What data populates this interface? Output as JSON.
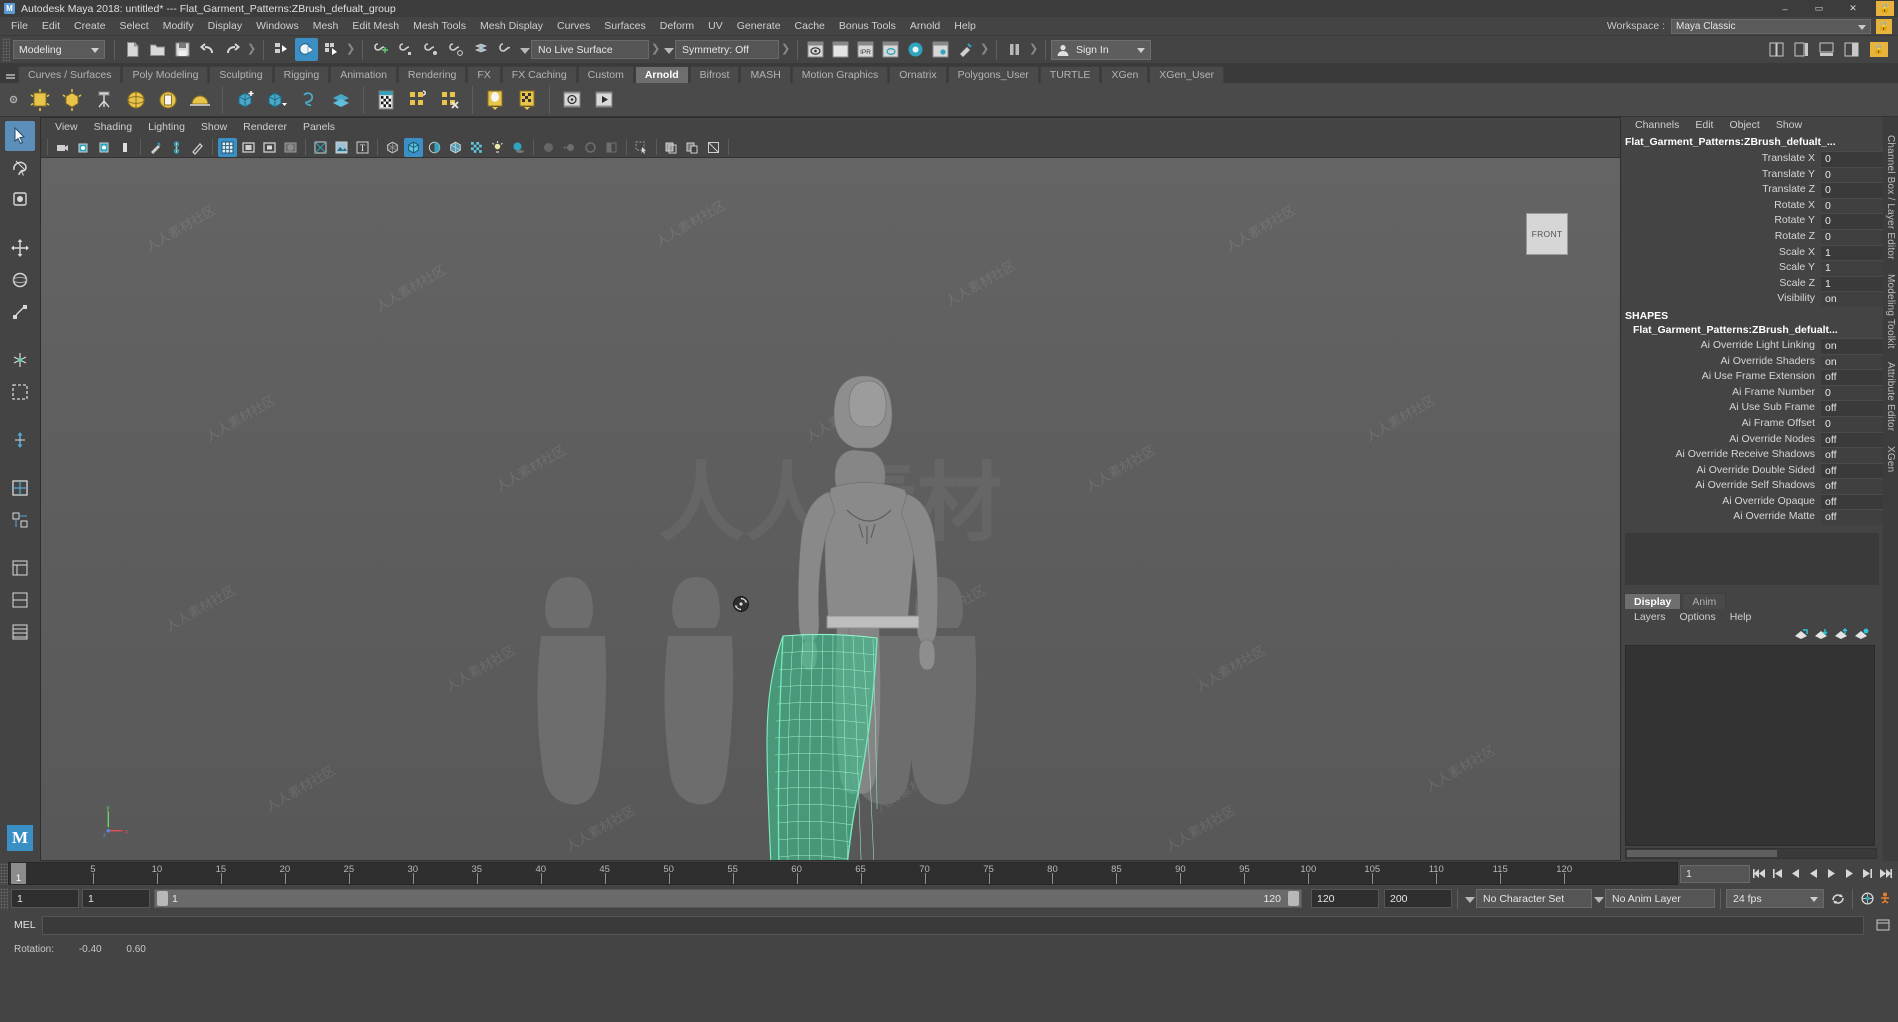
{
  "titlebar": {
    "app_title": "Autodesk Maya 2018: untitled*   ---   Flat_Garment_Patterns:ZBrush_defualt_group",
    "logo": "M",
    "minimize": "–",
    "maximize": "▭",
    "close": "✕",
    "lock_icon": "lock-icon"
  },
  "menubar": {
    "items": [
      "File",
      "Edit",
      "Create",
      "Select",
      "Modify",
      "Display",
      "Windows",
      "Mesh",
      "Edit Mesh",
      "Mesh Tools",
      "Mesh Display",
      "Curves",
      "Surfaces",
      "Deform",
      "UV",
      "Generate",
      "Cache",
      "Bonus Tools",
      "Arnold",
      "Help"
    ],
    "workspace_label": "Workspace :",
    "workspace_value": "Maya Classic"
  },
  "statusline": {
    "mode": "Modeling",
    "live_surface": "No Live Surface",
    "symmetry": "Symmetry: Off",
    "signin": "Sign In"
  },
  "shelf": {
    "tabs": [
      "Curves / Surfaces",
      "Poly Modeling",
      "Sculpting",
      "Rigging",
      "Animation",
      "Rendering",
      "FX",
      "FX Caching",
      "Custom",
      "Arnold",
      "Bifrost",
      "MASH",
      "Motion Graphics",
      "Ornatrix",
      "Polygons_User",
      "TURTLE",
      "XGen",
      "XGen_User"
    ],
    "active_tab": "Arnold",
    "icons": [
      "arnold-area-light-icon",
      "arnold-mesh-light-icon",
      "arnold-photometric-light-icon",
      "arnold-skydome-light-icon",
      "arnold-light-portal-icon",
      "arnold-physical-sky-icon",
      "arnold-standin-create-icon",
      "arnold-standin-export-icon",
      "arnold-volume-icon",
      "arnold-alembic-icon",
      "arnold-render-view-icon",
      "arnold-flare-icon",
      "arnold-flare-off-icon",
      "arnold-scene-source-icon",
      "arnold-bake-geo-icon",
      "arnold-open-vdb-icon",
      "arnold-sequence-icon"
    ]
  },
  "toolbox": {
    "tools": [
      "select-tool",
      "lasso-select-tool",
      "paint-select-tool",
      "move-tool",
      "rotate-tool",
      "scale-tool",
      "universal-manipulator-tool",
      "soft-select-tool",
      "last-tool-used",
      "snap-align-tool",
      "show-manipulator-tool",
      "outliner-panel-tool",
      "persp-view-panel-tool",
      "four-view-panel-tool",
      "hypershade-panel-tool"
    ],
    "logo": "M"
  },
  "viewport": {
    "menus": [
      "View",
      "Shading",
      "Lighting",
      "Show",
      "Renderer",
      "Panels"
    ],
    "toolbar_icons": [
      "select-camera-icon",
      "camera-attributes-icon",
      "bookmarks-icon",
      "image-plane-icon",
      "grease-pencil-icon",
      "twopointoo-icon",
      "grease-eraser-icon",
      "grid-display-icon",
      "film-gate-icon",
      "resolution-gate-icon",
      "gate-mask-icon",
      "exposure-icon",
      "display-image-icon",
      "text-overlay-icon",
      "wireframe-shading-icon",
      "smooth-shade-all-icon",
      "flat-shade-icon",
      "shaded-wireframe-icon",
      "textured-icon",
      "use-all-lights-icon",
      "shadows-icon",
      "screen-space-ao-icon",
      "motion-blur-icon",
      "aa-icon",
      "gamma-icon",
      "isolate-select-icon",
      "xray-icon",
      "xray-joints-icon",
      "no-manip-icon"
    ],
    "view_label": "FRONT",
    "axis_x": "x",
    "axis_y": "y",
    "axis_z": "z",
    "watermark": "人人素材社区",
    "watermark_center": "人人素材"
  },
  "channelbox": {
    "menus": [
      "Channels",
      "Edit",
      "Object",
      "Show"
    ],
    "object_name": "Flat_Garment_Patterns:ZBrush_defualt_...",
    "transform_rows": [
      {
        "attr": "Translate X",
        "value": "0"
      },
      {
        "attr": "Translate Y",
        "value": "0"
      },
      {
        "attr": "Translate Z",
        "value": "0"
      },
      {
        "attr": "Rotate X",
        "value": "0"
      },
      {
        "attr": "Rotate Y",
        "value": "0"
      },
      {
        "attr": "Rotate Z",
        "value": "0"
      },
      {
        "attr": "Scale X",
        "value": "1"
      },
      {
        "attr": "Scale Y",
        "value": "1"
      },
      {
        "attr": "Scale Z",
        "value": "1"
      },
      {
        "attr": "Visibility",
        "value": "on"
      }
    ],
    "shapes_label": "SHAPES",
    "shape_name": "Flat_Garment_Patterns:ZBrush_defualt...",
    "shape_rows": [
      {
        "attr": "Ai Override Light Linking",
        "value": "on"
      },
      {
        "attr": "Ai Override Shaders",
        "value": "on"
      },
      {
        "attr": "Ai Use Frame Extension",
        "value": "off"
      },
      {
        "attr": "Ai Frame Number",
        "value": "0"
      },
      {
        "attr": "Ai Use Sub Frame",
        "value": "off"
      },
      {
        "attr": "Ai Frame Offset",
        "value": "0"
      },
      {
        "attr": "Ai Override Nodes",
        "value": "off"
      },
      {
        "attr": "Ai Override Receive Shadows",
        "value": "off"
      },
      {
        "attr": "Ai Override Double Sided",
        "value": "off"
      },
      {
        "attr": "Ai Override Self Shadows",
        "value": "off"
      },
      {
        "attr": "Ai Override Opaque",
        "value": "off"
      },
      {
        "attr": "Ai Override Matte",
        "value": "off"
      }
    ]
  },
  "layereditor": {
    "tabs": [
      "Display",
      "Anim"
    ],
    "active_tab": "Display",
    "menus": [
      "Layers",
      "Options",
      "Help"
    ],
    "icons": [
      "new-layer-icon",
      "new-layer-from-selected-icon",
      "layer-up-icon",
      "layer-down-icon"
    ]
  },
  "vtabs": [
    "Channel Box / Layer Editor",
    "Modeling Toolkit",
    "Attribute Editor",
    "XGen"
  ],
  "timeline": {
    "ticks": [
      5,
      10,
      15,
      20,
      25,
      30,
      35,
      40,
      45,
      50,
      55,
      60,
      65,
      70,
      75,
      80,
      85,
      90,
      95,
      100,
      105,
      110,
      115,
      120
    ],
    "current_frame": "1",
    "end_field": "1",
    "playback_icons": [
      "go-to-start-icon",
      "step-back-key-icon",
      "step-back-frame-icon",
      "play-backwards-icon",
      "play-forwards-icon",
      "step-forward-frame-icon",
      "step-forward-key-icon",
      "go-to-end-icon"
    ]
  },
  "rangeslider": {
    "anim_start": "1",
    "range_start": "1",
    "bar_start_label": "1",
    "bar_end_label": "120",
    "range_end": "120",
    "anim_end": "200",
    "character_set": "No Character Set",
    "anim_layer": "No Anim Layer",
    "fps": "24 fps",
    "icons": [
      "auto-key-icon",
      "animation-preferences-icon",
      "cycle-icon"
    ]
  },
  "commandline": {
    "mel_label": "MEL",
    "mel_value": "",
    "mel_placeholder": "",
    "script_editor_icon": "script-editor-icon"
  },
  "status": {
    "label": "Rotation:",
    "value1": "-0.40",
    "value2": "0.60"
  },
  "colors": {
    "accent": "#3a8fc4",
    "mesh_green": "#4fd9a0",
    "panel_bg": "#444444",
    "dark_bg": "#333333",
    "yellow": "#e8b33c"
  }
}
